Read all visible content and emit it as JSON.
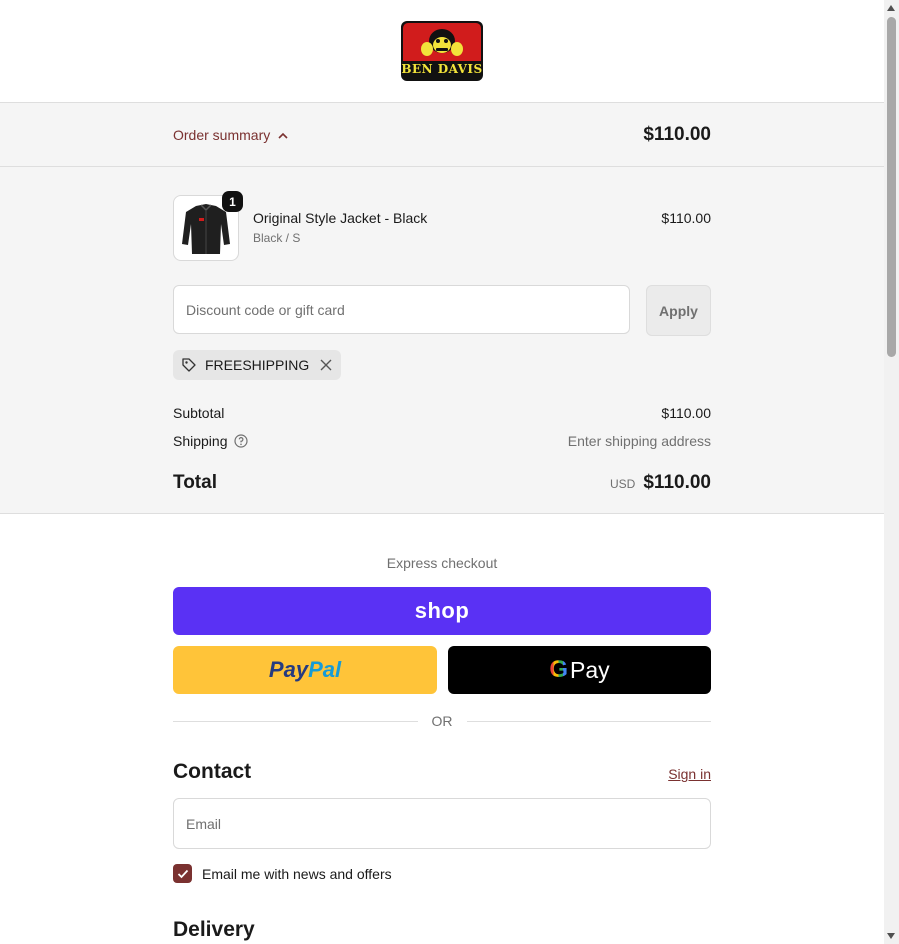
{
  "brand": {
    "logo_text": "BEN DAVIS"
  },
  "summary_toggle": {
    "label": "Order summary",
    "total": "$110.00"
  },
  "product": {
    "name": "Original Style Jacket - Black",
    "variant": "Black / S",
    "price": "$110.00",
    "quantity": "1"
  },
  "discount": {
    "placeholder": "Discount code or gift card",
    "apply_label": "Apply",
    "applied_code": "FREESHIPPING"
  },
  "totals": {
    "subtotal_label": "Subtotal",
    "subtotal_value": "$110.00",
    "shipping_label": "Shipping",
    "shipping_value": "Enter shipping address",
    "total_label": "Total",
    "currency": "USD",
    "total_value": "$110.00"
  },
  "express": {
    "label": "Express checkout",
    "shop_label": "shop",
    "paypal_label_1": "Pay",
    "paypal_label_2": "Pal",
    "gpay_g": "G",
    "gpay_label": "Pay",
    "or_label": "OR"
  },
  "contact": {
    "title": "Contact",
    "signin_label": "Sign in",
    "email_placeholder": "Email",
    "newsletter_label": "Email me with news and offers",
    "newsletter_checked": true
  },
  "delivery": {
    "title": "Delivery"
  },
  "colors": {
    "accent": "#7a3130",
    "shop": "#5a31f4",
    "paypal": "#ffc439",
    "gpay": "#000000"
  }
}
